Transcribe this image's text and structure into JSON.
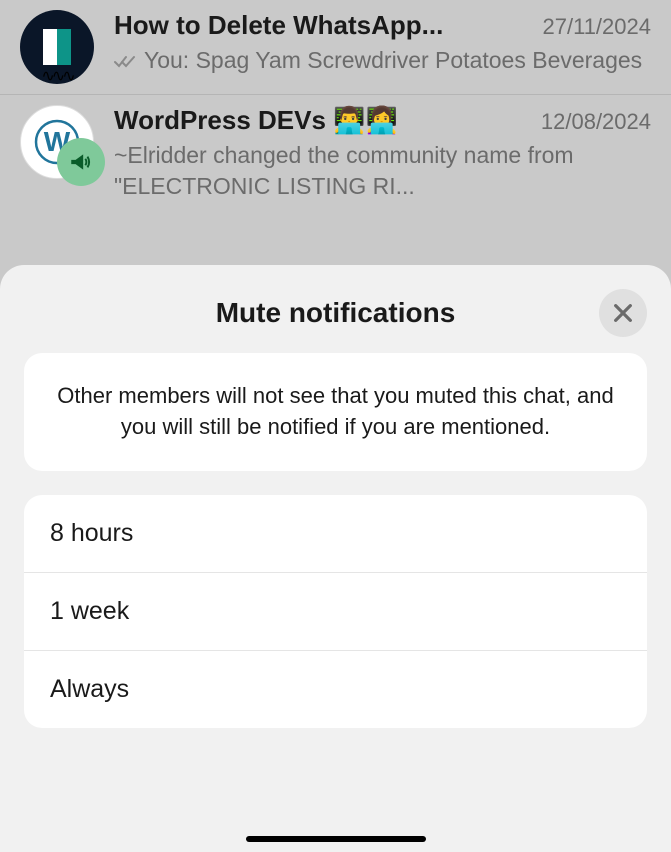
{
  "chats": [
    {
      "title": "How to Delete WhatsApp...",
      "date": "27/11/2024",
      "message_prefix": "You:",
      "message": "Spag Yam  Screwdriver  Potatoes  Beverages"
    },
    {
      "title": "WordPress DEVs 👨‍💻👩‍💻",
      "date": "12/08/2024",
      "message": "~Elridder changed the community name from \"ELECTRONIC LISTING RI..."
    }
  ],
  "sheet": {
    "title": "Mute notifications",
    "info": "Other members will not see that you muted this chat, and you will still be notified if you are mentioned.",
    "options": [
      "8 hours",
      "1 week",
      "Always"
    ]
  }
}
